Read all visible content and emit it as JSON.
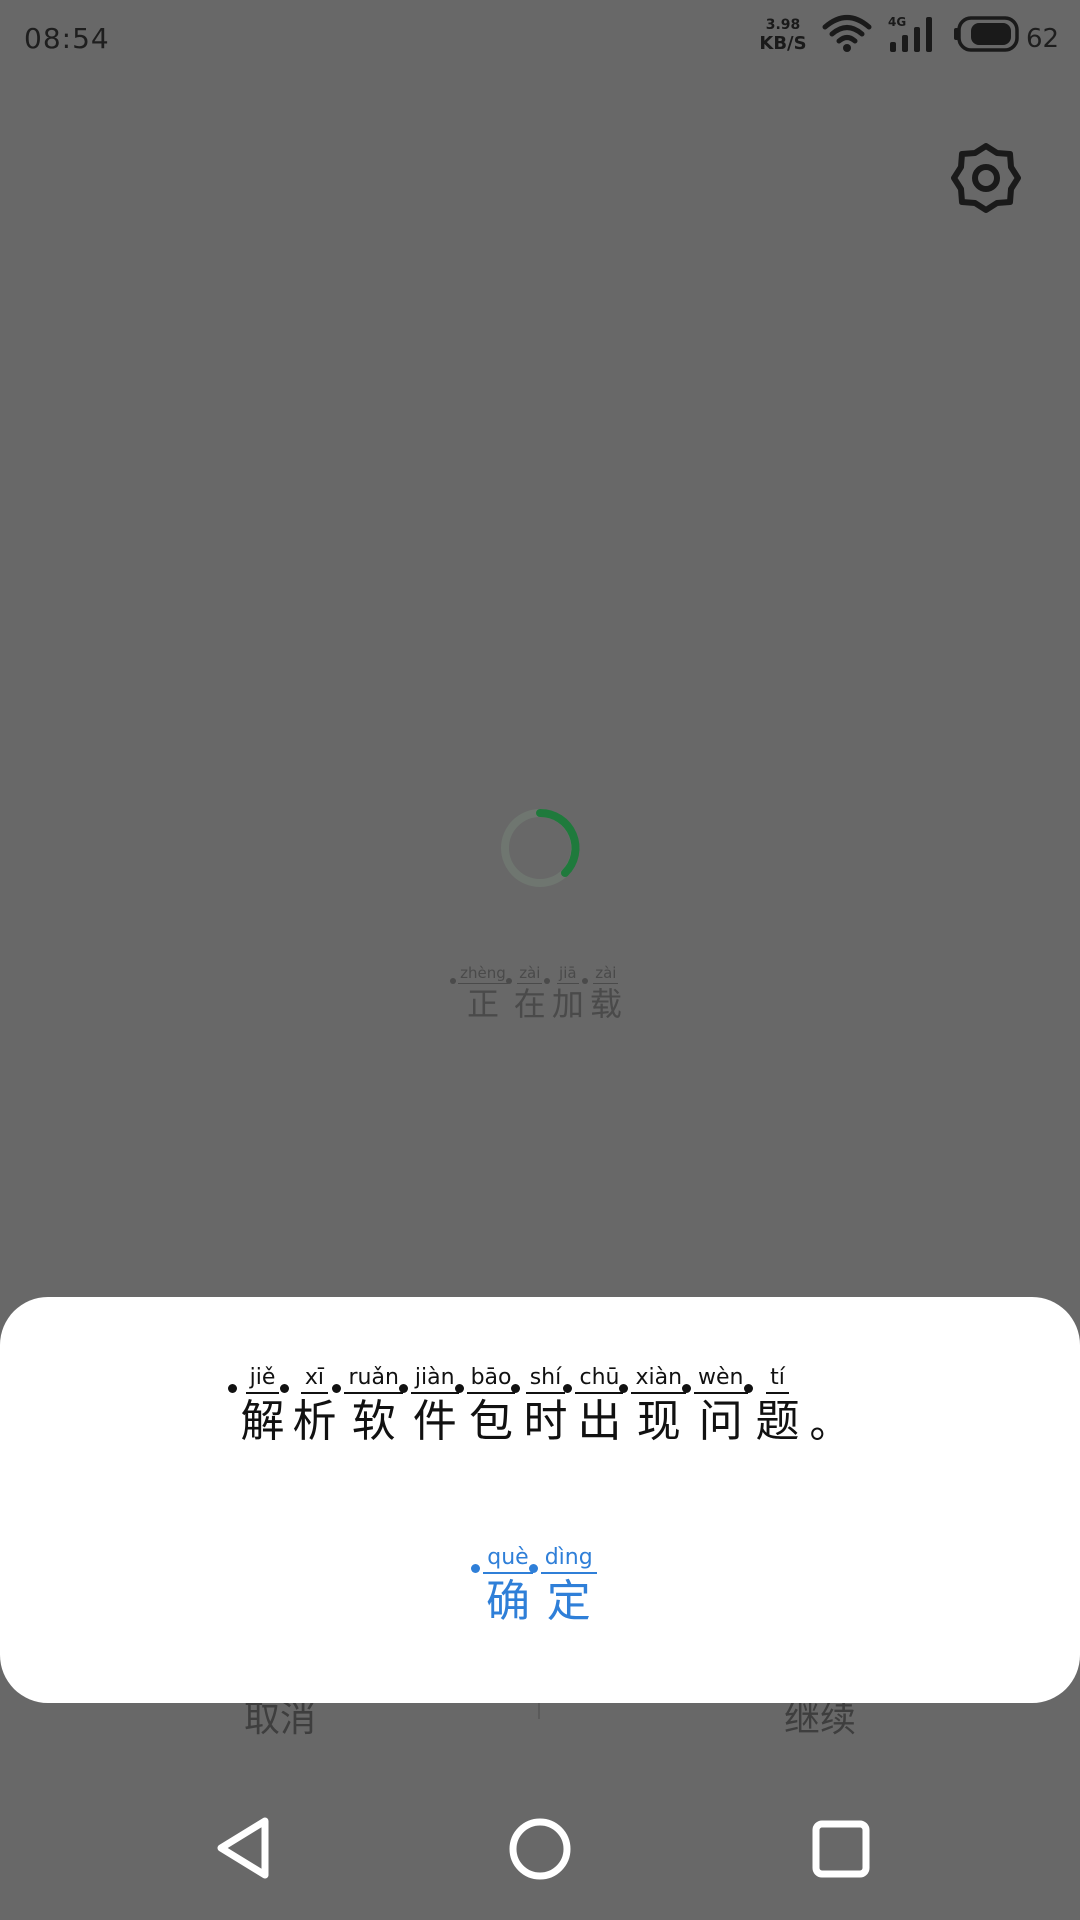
{
  "status_bar": {
    "time": "08:54",
    "net_speed_value": "3.98",
    "net_speed_unit": "KB/S",
    "network_type": "4G",
    "battery": "62",
    "icons": [
      "wifi-icon",
      "cellular-signal-icon",
      "battery-icon"
    ]
  },
  "toolbar": {
    "settings_icon": "gear-icon"
  },
  "loading": {
    "spinner_color": "#1f7a3c",
    "text": [
      {
        "pinyin": "zhèng",
        "char": "正"
      },
      {
        "pinyin": "zài",
        "char": "在"
      },
      {
        "pinyin": "jiā",
        "char": "加"
      },
      {
        "pinyin": "zài",
        "char": "载"
      }
    ]
  },
  "underlying_dialog": {
    "cancel_label": "取消",
    "continue_label": "继续"
  },
  "dialog": {
    "message": [
      {
        "pinyin": "jiě",
        "char": "解"
      },
      {
        "pinyin": "xī",
        "char": "析"
      },
      {
        "pinyin": "ruǎn",
        "char": "软"
      },
      {
        "pinyin": "jiàn",
        "char": "件"
      },
      {
        "pinyin": "bāo",
        "char": "包"
      },
      {
        "pinyin": "shí",
        "char": "时"
      },
      {
        "pinyin": "chū",
        "char": "出"
      },
      {
        "pinyin": "xiàn",
        "char": "现"
      },
      {
        "pinyin": "wèn",
        "char": "问"
      },
      {
        "pinyin": "tí",
        "char": "题"
      }
    ],
    "message_end": "。",
    "confirm": [
      {
        "pinyin": "què",
        "char": "确"
      },
      {
        "pinyin": "dìng",
        "char": "定"
      }
    ],
    "accent_color": "#2f7fd8"
  },
  "nav_bar": {
    "icons": [
      "back-icon",
      "home-icon",
      "recent-apps-icon"
    ]
  }
}
